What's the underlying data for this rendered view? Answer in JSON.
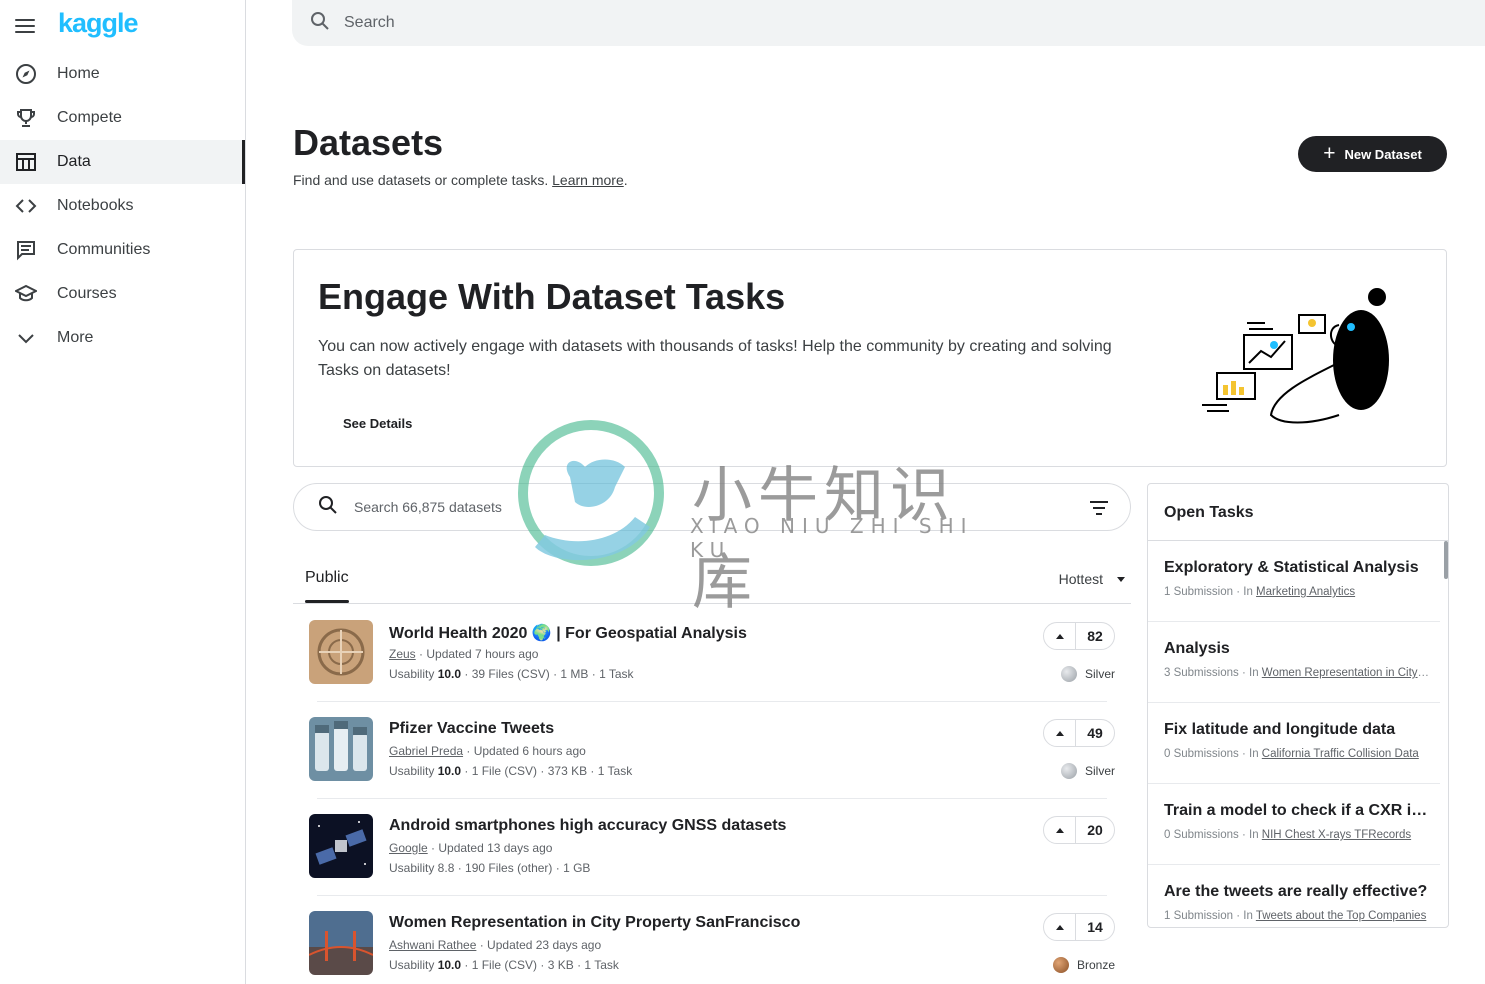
{
  "brand": {
    "logo_text": "kaggle",
    "logo_color": "#20beff"
  },
  "sidebar": {
    "items": [
      {
        "label": "Home",
        "icon": "compass-icon",
        "active": false
      },
      {
        "label": "Compete",
        "icon": "trophy-icon",
        "active": false
      },
      {
        "label": "Data",
        "icon": "table-icon",
        "active": true
      },
      {
        "label": "Notebooks",
        "icon": "code-icon",
        "active": false
      },
      {
        "label": "Communities",
        "icon": "discussion-icon",
        "active": false
      },
      {
        "label": "Courses",
        "icon": "school-icon",
        "active": false
      },
      {
        "label": "More",
        "icon": "chevron-down-icon",
        "active": false
      }
    ]
  },
  "search": {
    "placeholder": "Search"
  },
  "header": {
    "title": "Datasets",
    "subtitle": "Find and use datasets or complete tasks.",
    "learn_more": "Learn more",
    "new_dataset_label": "New Dataset"
  },
  "banner": {
    "title": "Engage With Dataset Tasks",
    "body": "You can now actively engage with datasets with thousands of tasks! Help the community by creating and solving Tasks on datasets!",
    "cta": "See Details"
  },
  "dataset_search": {
    "placeholder": "Search 66,875 datasets"
  },
  "tabs": {
    "public": "Public",
    "sort": "Hottest"
  },
  "datasets": [
    {
      "title": "World Health 2020 🌍 | For Geospatial Analysis",
      "author": "Zeus",
      "updated": " · Updated 7 hours ago",
      "usability_label": "Usability ",
      "usability": "10.0",
      "details": " · 39 Files (CSV) · 1 MB · 1 Task",
      "votes": "82",
      "medal": "Silver"
    },
    {
      "title": "Pfizer Vaccine Tweets",
      "author": "Gabriel Preda",
      "updated": " · Updated 6 hours ago",
      "usability_label": "Usability ",
      "usability": "10.0",
      "details": " · 1 File (CSV) · 373 KB · 1 Task",
      "votes": "49",
      "medal": "Silver"
    },
    {
      "title": "Android smartphones high accuracy GNSS datasets",
      "author": "Google",
      "updated": " · Updated 13 days ago",
      "usability_label": "Usability 8.8",
      "usability": "",
      "details": " · 190 Files (other) · 1 GB",
      "votes": "20",
      "medal": ""
    },
    {
      "title": "Women Representation in City Property SanFrancisco",
      "author": "Ashwani Rathee",
      "updated": " · Updated 23 days ago",
      "usability_label": "Usability ",
      "usability": "10.0",
      "details": " · 1 File (CSV) · 3 KB · 1 Task",
      "votes": "14",
      "medal": "Bronze"
    }
  ],
  "open_tasks": {
    "title": "Open Tasks",
    "items": [
      {
        "title": "Exploratory & Statistical Analysis",
        "submissions": "1 Submission · In ",
        "dataset": "Marketing Analytics"
      },
      {
        "title": "Analysis",
        "submissions": "3 Submissions · In ",
        "dataset": "Women Representation in City Property SanFrancisco"
      },
      {
        "title": "Fix latitude and longitude data",
        "submissions": "0 Submissions · In ",
        "dataset": "California Traffic Collision Data"
      },
      {
        "title": "Train a model to check if a CXR is normal",
        "submissions": "0 Submissions · In ",
        "dataset": "NIH Chest X-rays TFRecords"
      },
      {
        "title": "Are the tweets are really effective?",
        "submissions": "1 Submission · In ",
        "dataset": "Tweets about the Top Companies"
      }
    ]
  },
  "watermark": {
    "cn": "小牛知识库",
    "en": "XIAO NIU ZHI SHI KU"
  },
  "colors": {
    "silver": "#9aa0a6",
    "bronze": "#b5703a",
    "accent": "#202124"
  }
}
